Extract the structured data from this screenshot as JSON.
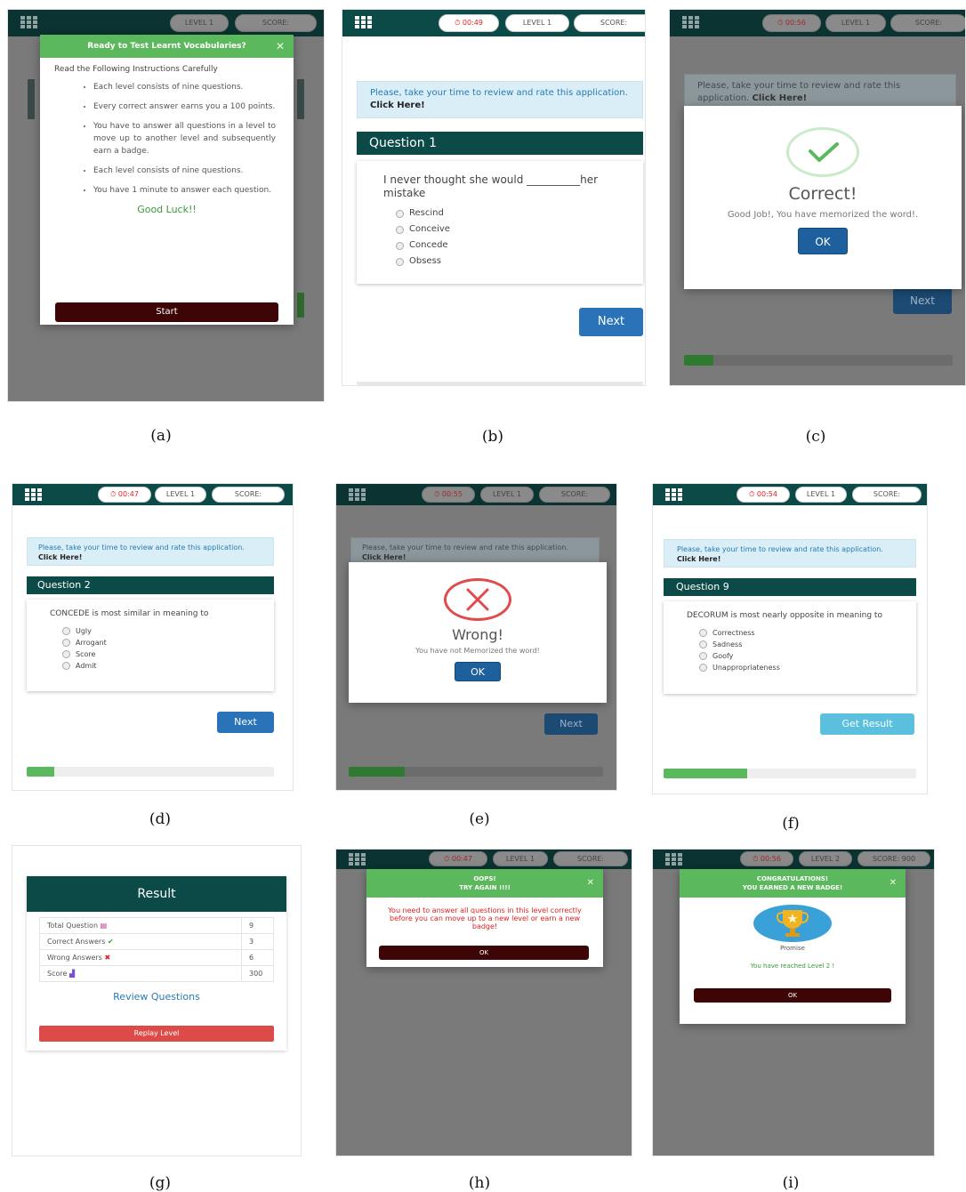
{
  "common": {
    "level_label": "LEVEL 1",
    "score_label": "SCORE:",
    "info_text": "Please, take your time to review and rate this application.",
    "info_link": "Click Here!",
    "next_label": "Next"
  },
  "panel_a": {
    "caption": "(a)",
    "modal_title": "Ready to Test Learnt Vocabularies?",
    "intro": "Read the Following Instructions Carefully",
    "rules": [
      "Each level consists of nine questions.",
      "Every correct answer earns you a 100 points.",
      "You have to answer all questions in a level to move up to another level and subsequently earn a badge.",
      "Each level consists of nine questions.",
      "You have 1 minute to answer each question."
    ],
    "good_luck": "Good Luck!!",
    "start_label": "Start"
  },
  "panel_b": {
    "caption": "(b)",
    "timer": "00:49",
    "question_title": "Question 1",
    "question_text": "I never thought she would __________her mistake",
    "options": [
      "Rescind",
      "Conceive",
      "Concede",
      "Obsess"
    ]
  },
  "panel_c": {
    "caption": "(c)",
    "timer": "00:56",
    "title": "Correct!",
    "message": "Good Job!, You have memorized the word!.",
    "ok_label": "OK",
    "progress_percent": 11
  },
  "panel_d": {
    "caption": "(d)",
    "timer": "00:47",
    "question_title": "Question 2",
    "question_text": "CONCEDE is most similar in meaning to",
    "options": [
      "Ugly",
      "Arrogant",
      "Score",
      "Admit"
    ],
    "progress_percent": 11
  },
  "panel_e": {
    "caption": "(e)",
    "timer": "00:55",
    "title": "Wrong!",
    "message": "You have not Memorized the word!",
    "ok_label": "OK",
    "progress_percent": 22
  },
  "panel_f": {
    "caption": "(f)",
    "timer": "00:54",
    "question_title": "Question 9",
    "question_text": "DECORUM is most nearly opposite in meaning to",
    "options": [
      "Correctness",
      "Sadness",
      "Goofy",
      "Unappropriateness"
    ],
    "result_button": "Get Result",
    "progress_percent": 33
  },
  "panel_g": {
    "caption": "(g)",
    "title": "Result",
    "rows": [
      {
        "label": "Total Question",
        "value": "9"
      },
      {
        "label": "Correct Answers",
        "value": "3"
      },
      {
        "label": "Wrong Answers",
        "value": "6"
      },
      {
        "label": "Score",
        "value": "300"
      }
    ],
    "review_link": "Review Questions",
    "replay_label": "Replay Level"
  },
  "panel_h": {
    "caption": "(h)",
    "timer": "00:47",
    "modal_title_1": "OOPS!",
    "modal_title_2": "TRY AGAIN !!!!",
    "message": "You need to answer all questions in this level correctly before you can move up to a new level or earn a new badge!",
    "ok_label": "OK"
  },
  "panel_i": {
    "caption": "(i)",
    "timer": "00:56",
    "level_label": "LEVEL 2",
    "score_label": "SCORE: 900",
    "modal_title_1": "CONGRATULATIONS!",
    "modal_title_2": "YOU EARNED A NEW BADGE!",
    "badge_name": "Promise",
    "message": "You have reached Level 2 !",
    "ok_label": "OK"
  }
}
